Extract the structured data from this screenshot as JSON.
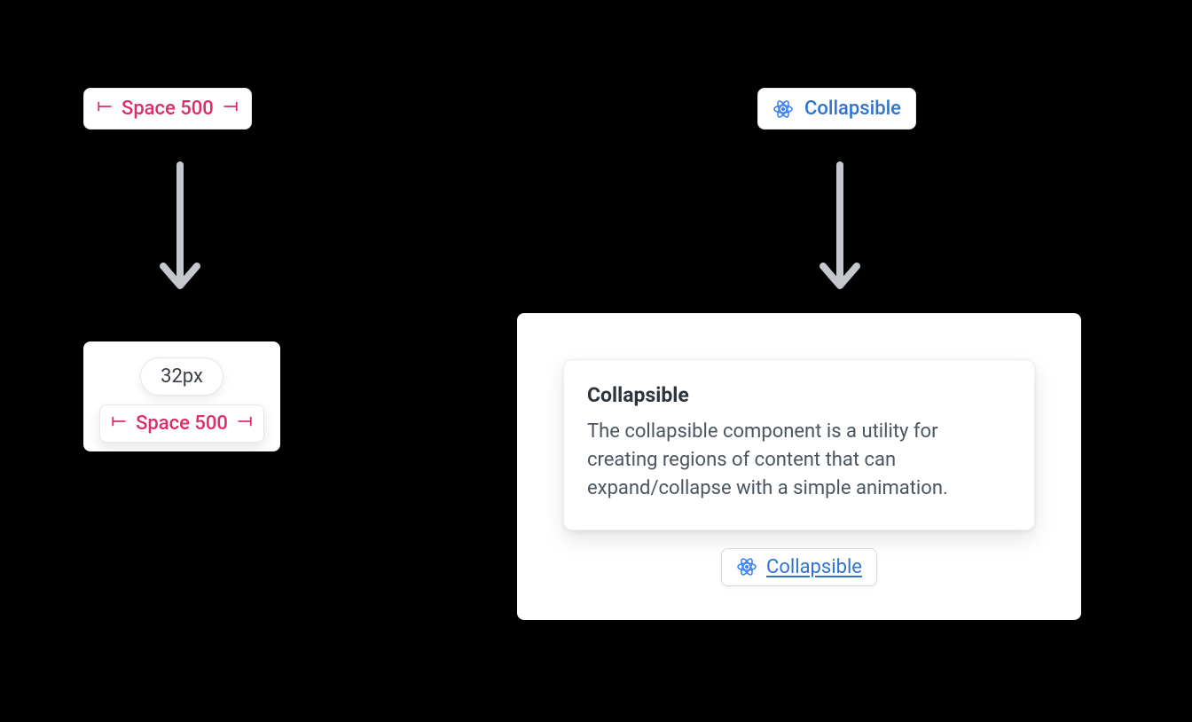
{
  "left": {
    "top_chip": {
      "label": "Space 500"
    },
    "hover": {
      "value": "32px",
      "chip_label": "Space 500"
    }
  },
  "right": {
    "top_chip": {
      "label": "Collapsible"
    },
    "card": {
      "title": "Collapsible",
      "description": "The collapsible component is a utility for creating regions of content that can expand/collapse with a simple animation."
    },
    "link_chip": {
      "label": "Collapsible"
    }
  }
}
